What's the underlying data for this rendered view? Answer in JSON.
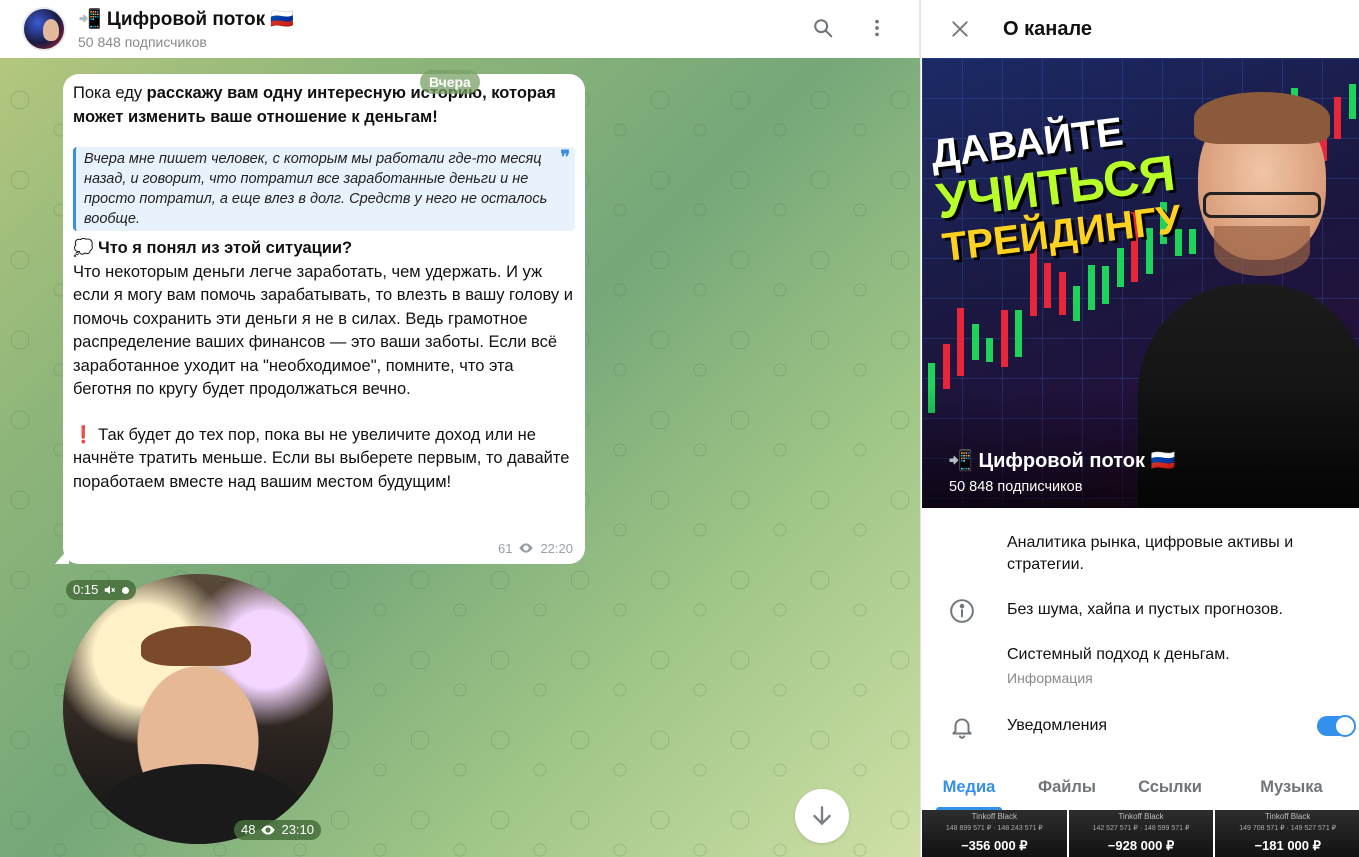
{
  "chat": {
    "channel_title": "📲 Цифровой поток 🇷🇺",
    "subscribers": "50 848 подписчиков",
    "date_pill": "Вчера",
    "message": {
      "intro_plain": "Пока еду ",
      "intro_bold": "расскажу вам одну интересную историю, которая может изменить ваше отношение к деньгам!",
      "quote": "Вчера мне пишет человек, с которым мы работали где-то месяц назад, и говорит, что потратил все заработанные деньги и не просто потратил, а еще влез в долг. Средств у него не осталось вообще.",
      "heading_emoji": "💭",
      "heading": "Что я понял из этой ситуации?",
      "body": "Что некоторым деньги легче заработать, чем удержать. И уж если я могу вам помочь зарабатывать, то влезть в вашу голову и помочь сохранить эти деньги я не в силах. Ведь грамотное распределение ваших финансов — это ваши заботы. Если всё заработанное уходит на \"необходимое\", помните, что эта беготня по кругу будет продолжаться вечно.",
      "closing_emoji": "❗",
      "closing": "Так будет до тех пор, пока вы не увеличите доход или не начнёте тратить меньше. Если вы выберете первым, то давайте поработаем вместе над вашим местом будущим!",
      "views": "61",
      "time": "22:20"
    },
    "video": {
      "duration": "0:15",
      "views": "48",
      "time": "23:10"
    }
  },
  "panel": {
    "title": "О канале",
    "cover": {
      "line1": "ДАВАЙТЕ",
      "line2": "УЧИТЬСЯ",
      "line3": "ТРЕЙДИНГУ",
      "name": "📲 Цифровой поток 🇷🇺",
      "subscribers": "50 848 подписчиков"
    },
    "description_1": "Аналитика рынка, цифровые активы и стратегии.",
    "description_2": "Без шума, хайпа и пустых прогнозов.",
    "description_3": "Системный подход к деньгам.",
    "info_label": "Информация",
    "notifications_label": "Уведомления",
    "notifications_on": true,
    "tabs": [
      "Медиа",
      "Файлы",
      "Ссылки",
      "Музыка"
    ],
    "thumbs": [
      {
        "card": "Tinkoff Black",
        "line": "148 899 571 ₽ · 148 243 571 ₽",
        "amount": "−356 000 ₽"
      },
      {
        "card": "Tinkoff Black",
        "line": "142 527 571 ₽ · 148 599 571 ₽",
        "amount": "−928 000 ₽"
      },
      {
        "card": "Tinkoff Black",
        "line": "149 708 571 ₽ · 149 527 571 ₽",
        "amount": "−181 000 ₽"
      }
    ]
  },
  "colors": {
    "accent": "#3390ec",
    "bubble": "#ffffff",
    "quote_bg": "#e8f2fc"
  }
}
